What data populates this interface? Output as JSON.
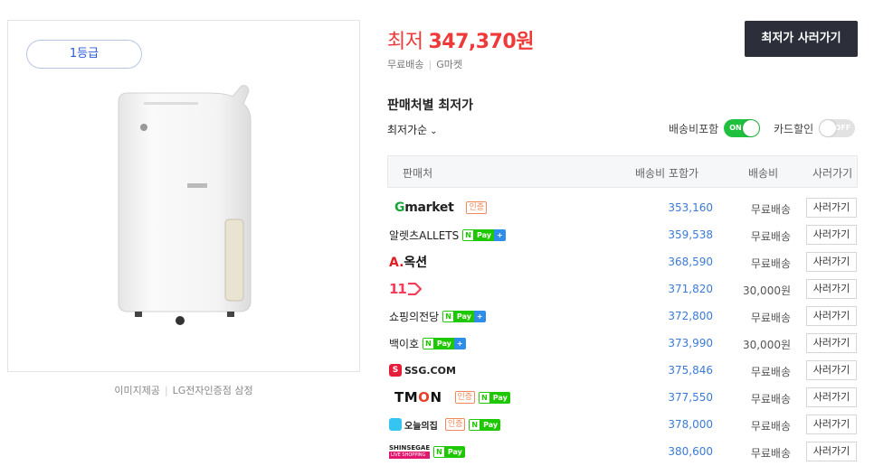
{
  "product": {
    "grade_badge": "1등급",
    "image_credit": "이미지제공",
    "image_source": "LG전자인증점 삼정"
  },
  "price": {
    "prefix": "최저",
    "amount": "347,370원",
    "shipping": "무료배송",
    "store": "G마켓",
    "buy_button": "최저가 사러가기"
  },
  "sellers_section": {
    "title": "판매처별 최저가",
    "sort_label": "최저가순",
    "toggle_shipping_label": "배송비포함",
    "toggle_shipping_state": "ON",
    "toggle_card_label": "카드할인",
    "toggle_card_state": "OFF",
    "columns": [
      "판매처",
      "배송비 포함가",
      "배송비",
      "사러가기"
    ]
  },
  "rows": [
    {
      "seller": "Gmarket",
      "logo": "gmarket-logo",
      "cert": "인증",
      "npay": "",
      "price": "353,160",
      "shipping": "무료배송",
      "buy": "사러가기"
    },
    {
      "seller": "알렛츠ALLETS",
      "logo": "",
      "cert": "",
      "npay": "Pay",
      "price": "359,538",
      "shipping": "무료배송",
      "buy": "사러가기"
    },
    {
      "seller": "옥션",
      "logo": "auction-logo",
      "cert": "",
      "npay": "",
      "price": "368,590",
      "shipping": "무료배송",
      "buy": "사러가기"
    },
    {
      "seller": "11",
      "logo": "11st-logo",
      "cert": "",
      "npay": "",
      "price": "371,820",
      "shipping": "30,000원",
      "buy": "사러가기"
    },
    {
      "seller": "쇼핑의전당",
      "logo": "",
      "cert": "",
      "npay": "Pay",
      "price": "372,800",
      "shipping": "무료배송",
      "buy": "사러가기"
    },
    {
      "seller": "백이호",
      "logo": "",
      "cert": "",
      "npay": "Pay",
      "price": "373,990",
      "shipping": "30,000원",
      "buy": "사러가기"
    },
    {
      "seller": "SSG.COM",
      "logo": "ssg-logo",
      "cert": "",
      "npay": "",
      "price": "375,846",
      "shipping": "무료배송",
      "buy": "사러가기"
    },
    {
      "seller": "TMON",
      "logo": "tmon-logo",
      "cert": "인증",
      "npay": "Pay",
      "price": "377,550",
      "shipping": "무료배송",
      "buy": "사러가기"
    },
    {
      "seller": "오늘의집",
      "logo": "ohouse-logo",
      "cert": "인증",
      "npay": "Pay",
      "price": "378,000",
      "shipping": "무료배송",
      "buy": "사러가기"
    },
    {
      "seller": "SHINSEGAE",
      "logo": "shinsegae-logo",
      "cert": "",
      "npay": "Pay",
      "price": "380,600",
      "shipping": "무료배송",
      "buy": "사러가기"
    }
  ],
  "logos": {
    "gmarket_g": "G",
    "gmarket_rest": "market",
    "auction_a": "A.",
    "auction_rest": "옥션",
    "ssg_box": "S",
    "tmon_t": "TM",
    "tmon_o": "O",
    "tmon_n": "N",
    "shinsegae_sub": "LIVE SHOPPING",
    "npay_n": "N",
    "npay_plus": "+"
  }
}
